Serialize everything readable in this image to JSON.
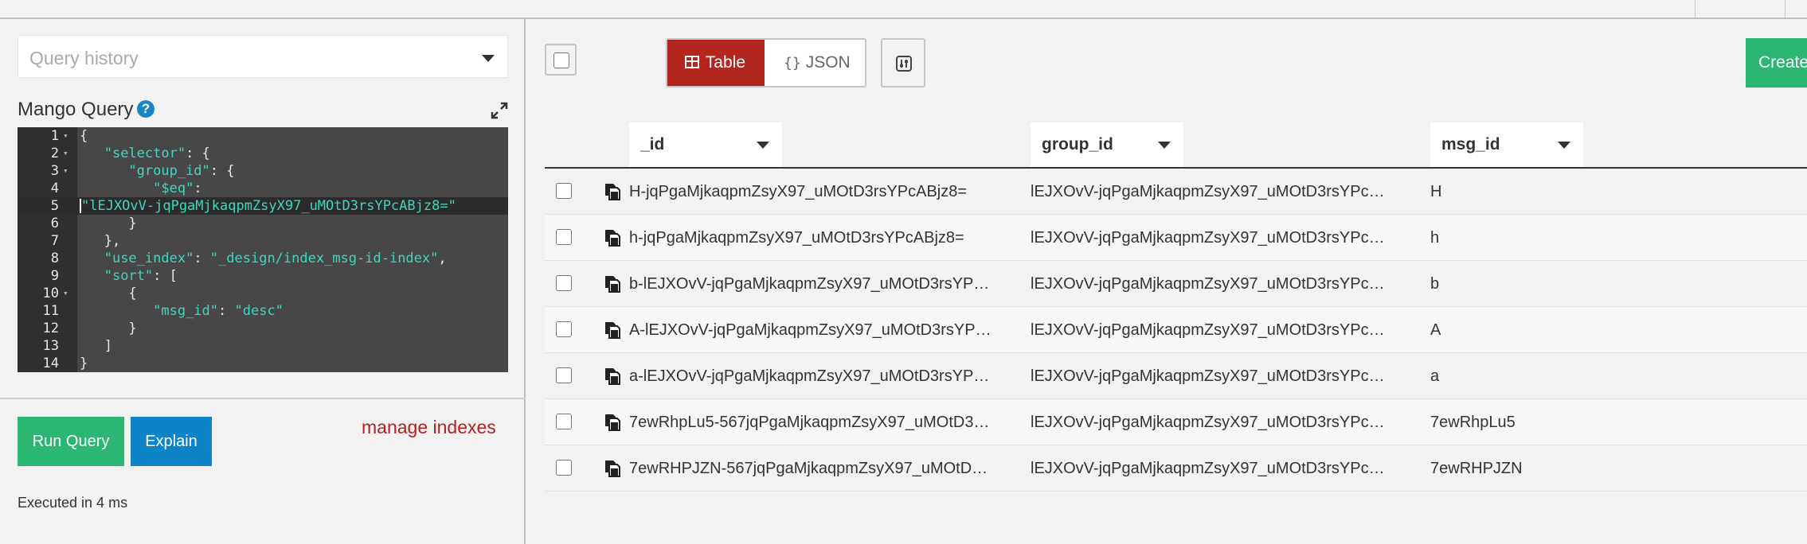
{
  "query_history": {
    "placeholder": "Query history"
  },
  "mango_query": {
    "label": "Mango Query",
    "help_icon": "?",
    "lines": [
      {
        "n": "1",
        "text": "{"
      },
      {
        "n": "2",
        "text": "   \"selector\": {"
      },
      {
        "n": "3",
        "text": "      \"group_id\": {"
      },
      {
        "n": "4",
        "text": "         \"$eq\":"
      },
      {
        "n": "5",
        "text": "\"lEJXOvV-jqPgaMjkaqpmZsyX97_uMOtD3rsYPcABjz8=\""
      },
      {
        "n": "6",
        "text": "      }"
      },
      {
        "n": "7",
        "text": "   },"
      },
      {
        "n": "8",
        "text": "   \"use_index\": \"_design/index_msg-id-index\","
      },
      {
        "n": "9",
        "text": "   \"sort\": ["
      },
      {
        "n": "10",
        "text": "      {"
      },
      {
        "n": "11",
        "text": "         \"msg_id\": \"desc\""
      },
      {
        "n": "12",
        "text": "      }"
      },
      {
        "n": "13",
        "text": "   ]"
      },
      {
        "n": "14",
        "text": "}"
      }
    ]
  },
  "actions": {
    "run_query": "Run Query",
    "explain": "Explain",
    "manage_indexes": "manage indexes",
    "executed": "Executed in 4 ms"
  },
  "toolbar": {
    "table_tab": "Table",
    "json_tab": "JSON",
    "json_icon": "{}",
    "create": "Create"
  },
  "table": {
    "columns": [
      "_id",
      "group_id",
      "msg_id"
    ],
    "rows": [
      {
        "id": "H-jqPgaMjkaqpmZsyX97_uMOtD3rsYPcABjz8=",
        "group_id": "lEJXOvV-jqPgaMjkaqpmZsyX97_uMOtD3rsYPc…",
        "msg_id": "H"
      },
      {
        "id": "h-jqPgaMjkaqpmZsyX97_uMOtD3rsYPcABjz8=",
        "group_id": "lEJXOvV-jqPgaMjkaqpmZsyX97_uMOtD3rsYPc…",
        "msg_id": "h"
      },
      {
        "id": "b-lEJXOvV-jqPgaMjkaqpmZsyX97_uMOtD3rsYP…",
        "group_id": "lEJXOvV-jqPgaMjkaqpmZsyX97_uMOtD3rsYPc…",
        "msg_id": "b"
      },
      {
        "id": "A-lEJXOvV-jqPgaMjkaqpmZsyX97_uMOtD3rsYP…",
        "group_id": "lEJXOvV-jqPgaMjkaqpmZsyX97_uMOtD3rsYPc…",
        "msg_id": "A"
      },
      {
        "id": "a-lEJXOvV-jqPgaMjkaqpmZsyX97_uMOtD3rsYP…",
        "group_id": "lEJXOvV-jqPgaMjkaqpmZsyX97_uMOtD3rsYPc…",
        "msg_id": "a"
      },
      {
        "id": "7ewRhpLu5-567jqPgaMjkaqpmZsyX97_uMOtD3…",
        "group_id": "lEJXOvV-jqPgaMjkaqpmZsyX97_uMOtD3rsYPc…",
        "msg_id": "7ewRhpLu5"
      },
      {
        "id": "7ewRHPJZN-567jqPgaMjkaqpmZsyX97_uMOtD…",
        "group_id": "lEJXOvV-jqPgaMjkaqpmZsyX97_uMOtD3rsYPc…",
        "msg_id": "7ewRHPJZN"
      }
    ]
  }
}
